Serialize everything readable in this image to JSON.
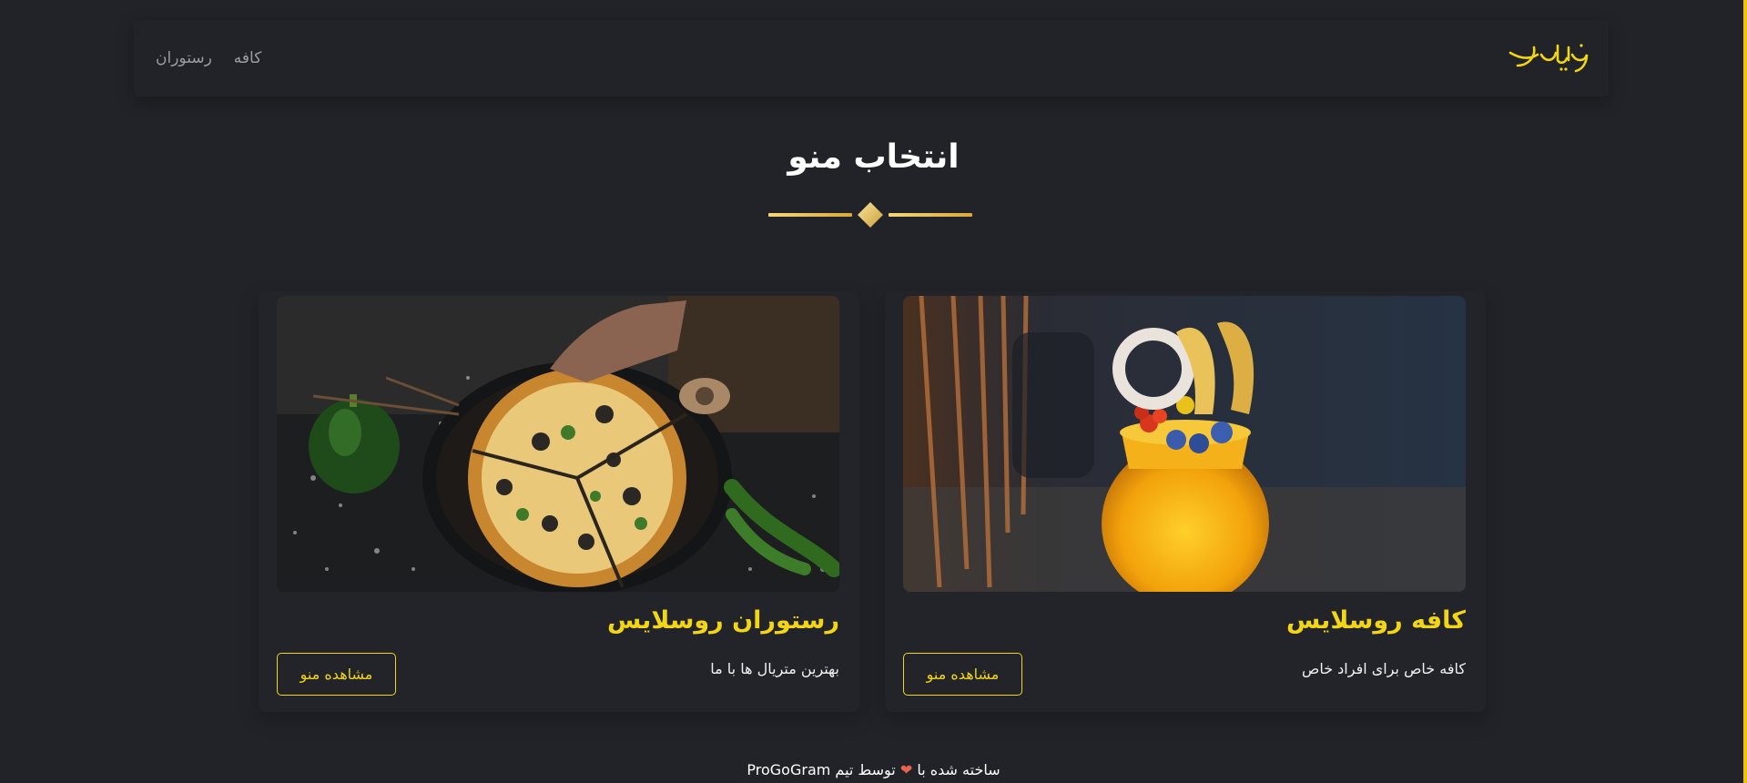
{
  "header": {
    "nav": [
      {
        "label": "کافه"
      },
      {
        "label": "رستوران"
      }
    ],
    "logo_text": "روسلایس"
  },
  "main": {
    "title": "انتخاب منو",
    "cards": [
      {
        "title": "رستوران روسلایس",
        "description": "بهترین متریال ها با ما",
        "button_label": "مشاهده منو",
        "image": "pizza-photo"
      },
      {
        "title": "کافه روسلایس",
        "description": "کافه خاص برای افراد خاص",
        "button_label": "مشاهده منو",
        "image": "mango-smoothie-photo"
      }
    ]
  },
  "footer": {
    "text_before": "ساخته شده با",
    "heart": "❤",
    "text_after": "توسط تیم ProGoGram"
  },
  "colors": {
    "background": "#212328",
    "accent_yellow": "#f2d515",
    "gold": "#e7c766",
    "muted_text": "#9a9ca0"
  }
}
